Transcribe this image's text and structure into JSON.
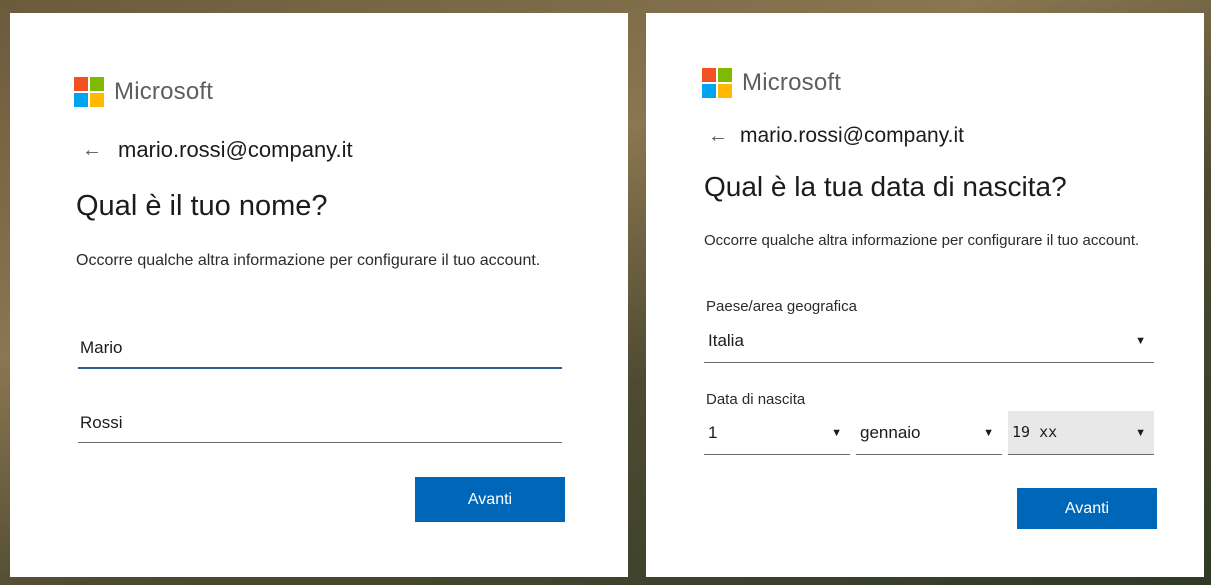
{
  "brand": {
    "name": "Microsoft",
    "colors": {
      "red": "#f25022",
      "green": "#7fba00",
      "blue": "#00a4ef",
      "yellow": "#ffb900"
    }
  },
  "left_panel": {
    "identity": {
      "back_icon": "←",
      "email": "mario.rossi@company.it"
    },
    "title": "Qual è il tuo nome?",
    "description": "Occorre qualche altra informazione per configurare il tuo account.",
    "first_name": {
      "value": "Mario"
    },
    "last_name": {
      "value": "Rossi"
    },
    "next_label": "Avanti"
  },
  "right_panel": {
    "identity": {
      "back_icon": "←",
      "email": "mario.rossi@company.it"
    },
    "title": "Qual è la tua data di nascita?",
    "description": "Occorre qualche altra informazione per configurare il tuo account.",
    "country_label": "Paese/area geografica",
    "country_value": "Italia",
    "birthdate_label": "Data di nascita",
    "day_value": "1",
    "month_value": "gennaio",
    "year_value": "19 xx",
    "caret_icon": "▼",
    "next_label": "Avanti"
  },
  "accent_color": "#0067b8"
}
